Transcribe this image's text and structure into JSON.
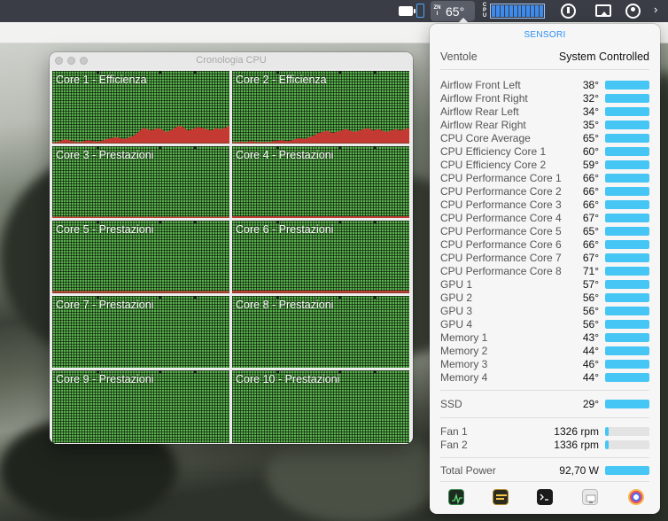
{
  "menubar": {
    "temp_small": "ZNI",
    "temp_value": "65°",
    "cpu_small": "CPU"
  },
  "cpu_window": {
    "title": "Cronologia CPU",
    "cores": [
      {
        "label": "Core 1 - Efficienza",
        "load": [
          0.02,
          0.02,
          0.05,
          0.08,
          0.05,
          0.03,
          0.02,
          0.04,
          0.06,
          0.04,
          0.03,
          0.05,
          0.08,
          0.1,
          0.12,
          0.1,
          0.08,
          0.12,
          0.15,
          0.22,
          0.3,
          0.28,
          0.25,
          0.3,
          0.28,
          0.22,
          0.25,
          0.3,
          0.35,
          0.3,
          0.25,
          0.28,
          0.32,
          0.3,
          0.28,
          0.25,
          0.3,
          0.28,
          0.3,
          0.35
        ]
      },
      {
        "label": "Core 2 - Efficienza",
        "load": [
          0.02,
          0.02,
          0.03,
          0.02,
          0.04,
          0.03,
          0.02,
          0.03,
          0.02,
          0.04,
          0.05,
          0.06,
          0.04,
          0.05,
          0.08,
          0.1,
          0.08,
          0.12,
          0.15,
          0.2,
          0.22,
          0.25,
          0.2,
          0.22,
          0.25,
          0.28,
          0.25,
          0.22,
          0.25,
          0.28,
          0.3,
          0.25,
          0.28,
          0.25,
          0.22,
          0.25,
          0.28,
          0.25,
          0.28,
          0.3
        ]
      },
      {
        "label": "Core 3 - Prestazioni",
        "load": [
          0.02
        ]
      },
      {
        "label": "Core 4 - Prestazioni",
        "load": [
          0.03
        ]
      },
      {
        "label": "Core 5 - Prestazioni",
        "load": [
          0.02
        ]
      },
      {
        "label": "Core 6 - Prestazioni",
        "load": [
          0.03
        ]
      },
      {
        "label": "Core 7 - Prestazioni",
        "load": [
          0.0
        ]
      },
      {
        "label": "Core 8 - Prestazioni",
        "load": [
          0.0
        ]
      },
      {
        "label": "Core 9 - Prestazioni",
        "load": [
          0.0
        ]
      },
      {
        "label": "Core 10 - Prestazioni",
        "load": [
          0.0
        ]
      }
    ]
  },
  "sensors": {
    "title": "SENSORI",
    "fans_mode_label": "Ventole",
    "fans_mode_value": "System Controlled",
    "temperatures": [
      {
        "label": "Airflow Front Left",
        "value": "38°"
      },
      {
        "label": "Airflow Front Right",
        "value": "32°"
      },
      {
        "label": "Airflow Rear Left",
        "value": "34°"
      },
      {
        "label": "Airflow Rear Right",
        "value": "35°"
      },
      {
        "label": "CPU Core Average",
        "value": "65°"
      },
      {
        "label": "CPU Efficiency Core 1",
        "value": "60°"
      },
      {
        "label": "CPU Efficiency Core 2",
        "value": "59°"
      },
      {
        "label": "CPU Performance Core 1",
        "value": "66°"
      },
      {
        "label": "CPU Performance Core 2",
        "value": "66°"
      },
      {
        "label": "CPU Performance Core 3",
        "value": "66°"
      },
      {
        "label": "CPU Performance Core 4",
        "value": "67°"
      },
      {
        "label": "CPU Performance Core 5",
        "value": "65°"
      },
      {
        "label": "CPU Performance Core 6",
        "value": "66°"
      },
      {
        "label": "CPU Performance Core 7",
        "value": "67°"
      },
      {
        "label": "CPU Performance Core 8",
        "value": "71°"
      },
      {
        "label": "GPU 1",
        "value": "57°"
      },
      {
        "label": "GPU 2",
        "value": "56°"
      },
      {
        "label": "GPU 3",
        "value": "56°"
      },
      {
        "label": "GPU 4",
        "value": "56°"
      },
      {
        "label": "Memory 1",
        "value": "43°"
      },
      {
        "label": "Memory 2",
        "value": "44°"
      },
      {
        "label": "Memory 3",
        "value": "46°"
      },
      {
        "label": "Memory 4",
        "value": "44°"
      }
    ],
    "ssd": {
      "label": "SSD",
      "value": "29°"
    },
    "fans": [
      {
        "label": "Fan 1",
        "value": "1326 rpm",
        "level": 0.08
      },
      {
        "label": "Fan 2",
        "value": "1336 rpm",
        "level": 0.08
      }
    ],
    "total_power": {
      "label": "Total Power",
      "value": "92,70 W"
    },
    "dock_icons": [
      "activity-monitor-icon",
      "console-icon",
      "terminal-icon",
      "system-information-icon",
      "colorsync-icon"
    ],
    "accent_color": "#46c6f5"
  }
}
